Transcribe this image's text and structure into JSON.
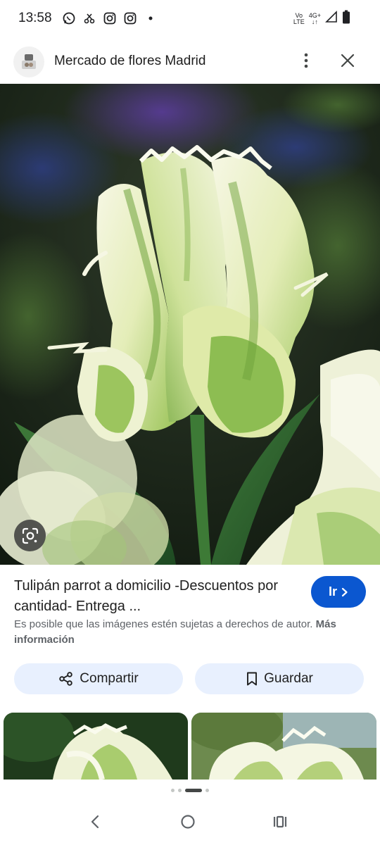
{
  "status_bar": {
    "time": "13:58",
    "left_icons": [
      "whatsapp-icon",
      "missed-call-icon",
      "instagram-icon",
      "instagram-icon",
      "dot-icon"
    ],
    "network_label_top": "Vo",
    "network_label_bottom": "LTE",
    "data_label_top": "4G+",
    "data_label_bottom": "↓↑",
    "right_icons": [
      "signal-icon",
      "battery-icon"
    ]
  },
  "header": {
    "title": "Mercado de flores Madrid"
  },
  "result": {
    "title": "Tulipán parrot a domicilio -Descuentos por cantidad- Entrega ...",
    "go_label": "Ir",
    "copyright_text": "Es posible que las imágenes estén sujetas a derechos de autor.",
    "more_info": "Más información"
  },
  "actions": {
    "share_label": "Compartir",
    "save_label": "Guardar"
  },
  "carousel": {
    "dots": 4,
    "active_index": 2
  },
  "colors": {
    "accent": "#0b57d0",
    "action_bg": "#e8f0fe"
  }
}
